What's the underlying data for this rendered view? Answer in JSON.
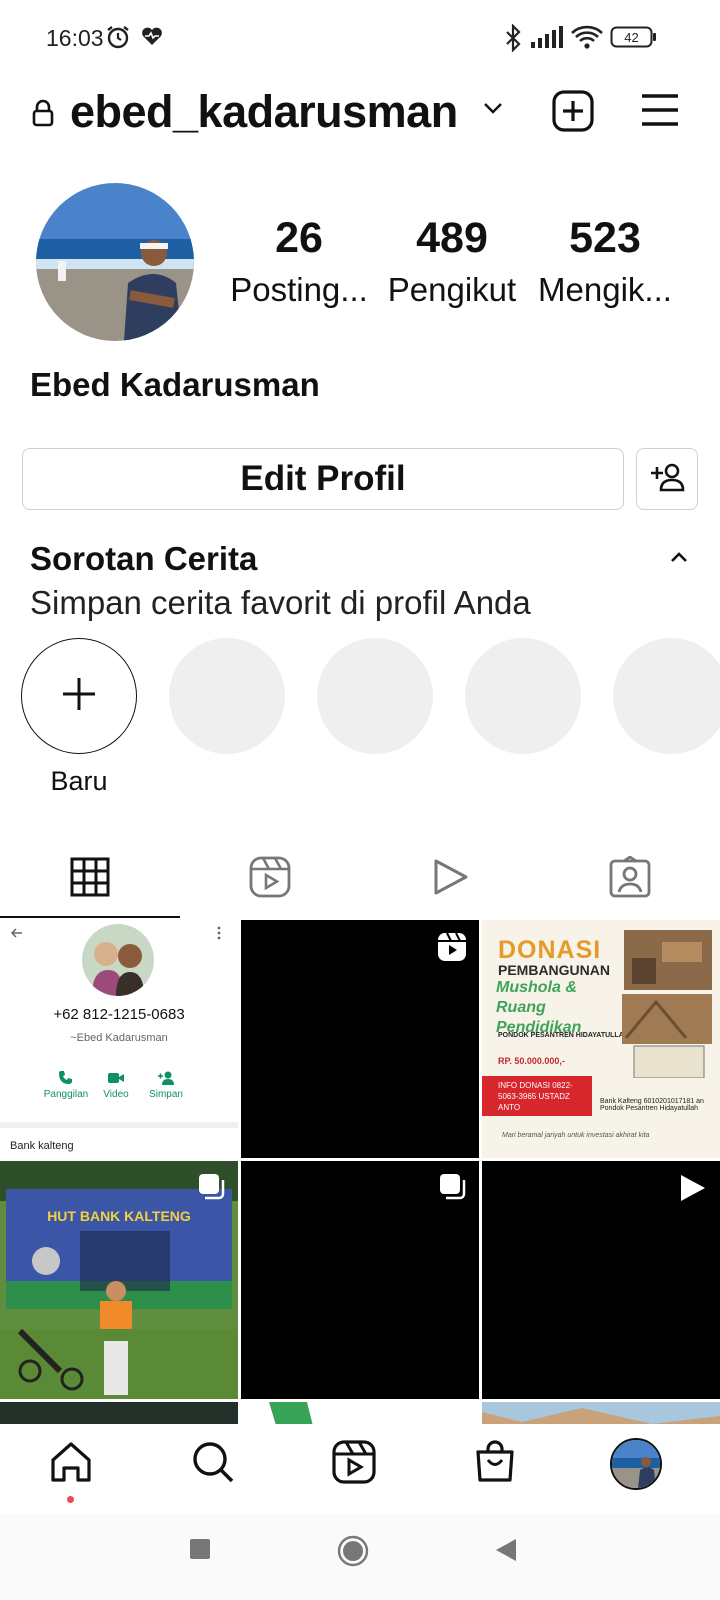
{
  "status_bar": {
    "time": "16:03",
    "battery": "42",
    "icons": [
      "alarm-icon",
      "heart-monitor-icon",
      "bluetooth-icon",
      "signal-icon",
      "wifi-icon",
      "battery-icon"
    ]
  },
  "header": {
    "username": "ebed_kadarusman",
    "icons": [
      "lock-icon",
      "chevron-down-icon",
      "new-post-icon",
      "menu-icon"
    ]
  },
  "profile": {
    "stats": [
      {
        "value": "26",
        "label": "Posting..."
      },
      {
        "value": "489",
        "label": "Pengikut"
      },
      {
        "value": "523",
        "label": "Mengik..."
      }
    ],
    "full_name": "Ebed Kadarusman",
    "edit_button": "Edit Profil"
  },
  "highlights": {
    "title": "Sorotan Cerita",
    "subtitle": "Simpan cerita favorit di profil Anda",
    "new_label": "Baru"
  },
  "tabs": [
    "grid-icon",
    "reels-icon",
    "video-icon",
    "tagged-icon"
  ],
  "posts": {
    "contact_card": {
      "phone": "+62 812-1215-0683",
      "name": "~Ebed Kadarusman",
      "actions": [
        "Panggilan",
        "Video",
        "Simpan"
      ],
      "footer": "Bank kalteng"
    },
    "donation_poster": {
      "title": "DONASI",
      "subtitle": "PEMBANGUNAN",
      "heading": "Mushola & Ruang Pendidikan",
      "org": "PONDOK PESANTREN HIDAYATULLAH",
      "amount": "RP. 50.000.000,-",
      "info": "INFO DONASI 0822-5063-3965 USTADZ ANTO",
      "bank": "Bank Kalteng 6010201017181 an Pondok Pesantren Hidayatullah",
      "footer": "Mari beramal jariyah untuk investasi akhirat kita"
    }
  },
  "bottom_nav": [
    "home-icon",
    "search-icon",
    "reels-icon",
    "shop-icon",
    "profile-avatar"
  ],
  "colors": {
    "notification_dot": "#ed4956",
    "placeholder": "#efefef",
    "border": "#d0d0d0"
  }
}
